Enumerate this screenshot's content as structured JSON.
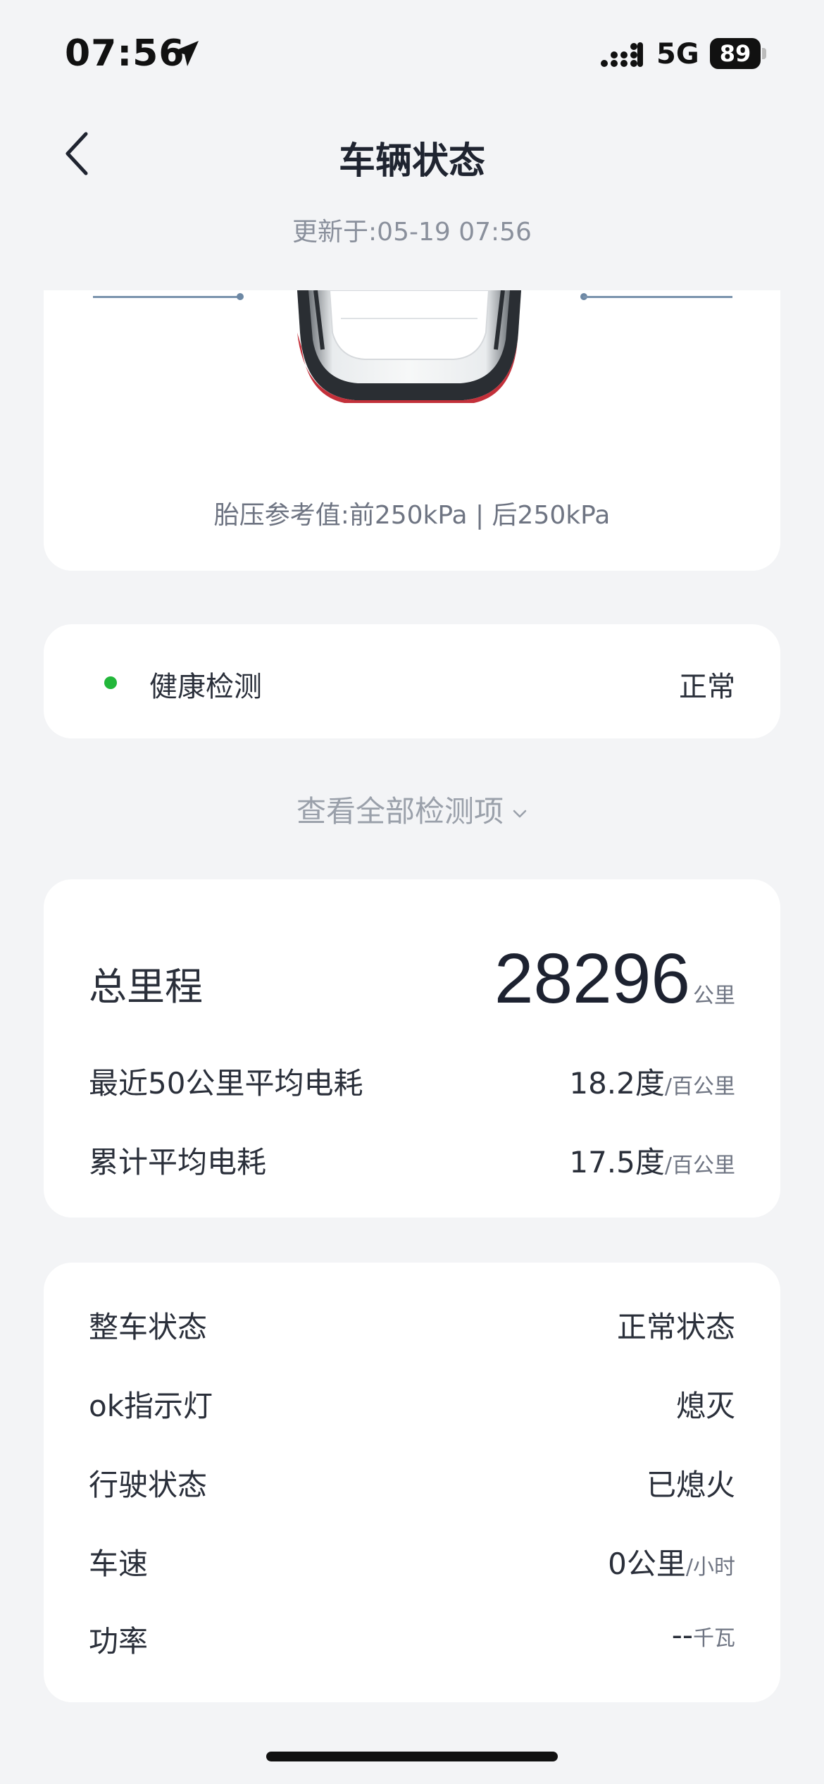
{
  "status_bar": {
    "time": "07:56",
    "network": "5G",
    "battery": "89"
  },
  "header": {
    "title": "车辆状态",
    "updated": "更新于:05-19 07:56"
  },
  "tire_card": {
    "reference": "胎压参考值:前250kPa | 后250kPa"
  },
  "health": {
    "label": "健康检测",
    "value": "正常",
    "dot_color": "#22b73a"
  },
  "view_all": {
    "label": "查看全部检测项"
  },
  "mileage": {
    "total_label": "总里程",
    "total_value": "28296",
    "total_unit": "公里",
    "rows": [
      {
        "label": "最近50公里平均电耗",
        "value": "18.2度",
        "unit": "/百公里"
      },
      {
        "label": "累计平均电耗",
        "value": "17.5度",
        "unit": "/百公里"
      }
    ]
  },
  "status_list": [
    {
      "label": "整车状态",
      "value": "正常状态",
      "unit": ""
    },
    {
      "label": "ok指示灯",
      "value": "熄灭",
      "unit": ""
    },
    {
      "label": "行驶状态",
      "value": "已熄火",
      "unit": ""
    },
    {
      "label": "车速",
      "value": "0公里",
      "unit": "/小时"
    },
    {
      "label": "功率",
      "value": "--",
      "unit": "千瓦"
    }
  ],
  "icons": {
    "back": "chevron-left-icon",
    "location": "location-arrow-icon",
    "signal": "cellular-signal-icon",
    "view_all": "chevron-down-icon"
  }
}
